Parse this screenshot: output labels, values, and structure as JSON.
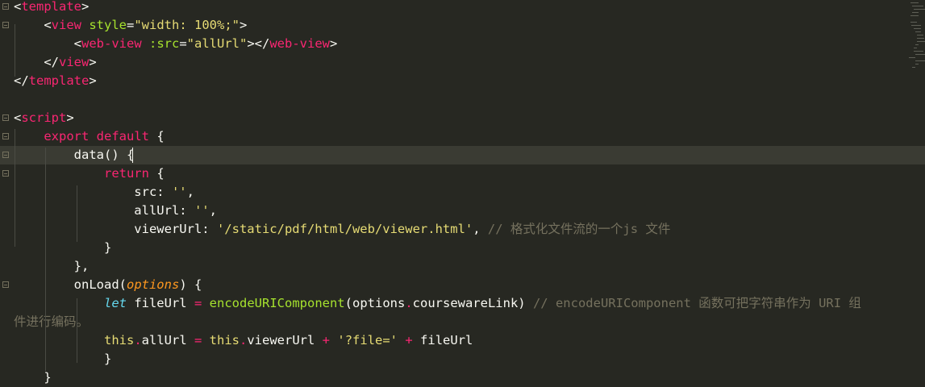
{
  "editor": {
    "lines": [
      [
        {
          "t": "<",
          "c": "w"
        },
        {
          "t": "template",
          "c": "t"
        },
        {
          "t": ">",
          "c": "w"
        }
      ],
      [
        {
          "t": "    <",
          "c": "w"
        },
        {
          "t": "view",
          "c": "t"
        },
        {
          "t": " style",
          "c": "a"
        },
        {
          "t": "=",
          "c": "w"
        },
        {
          "t": "\"width: 100%;\"",
          "c": "s"
        },
        {
          "t": ">",
          "c": "w"
        }
      ],
      [
        {
          "t": "        <",
          "c": "w"
        },
        {
          "t": "web-view",
          "c": "t"
        },
        {
          "t": " :src",
          "c": "a"
        },
        {
          "t": "=",
          "c": "w"
        },
        {
          "t": "\"allUrl\"",
          "c": "s"
        },
        {
          "t": "></",
          "c": "w"
        },
        {
          "t": "web-view",
          "c": "t"
        },
        {
          "t": ">",
          "c": "w"
        }
      ],
      [
        {
          "t": "    </",
          "c": "w"
        },
        {
          "t": "view",
          "c": "t"
        },
        {
          "t": ">",
          "c": "w"
        }
      ],
      [
        {
          "t": "</",
          "c": "w"
        },
        {
          "t": "template",
          "c": "t"
        },
        {
          "t": ">",
          "c": "w"
        }
      ],
      [],
      [
        {
          "t": "<",
          "c": "w"
        },
        {
          "t": "script",
          "c": "t"
        },
        {
          "t": ">",
          "c": "w"
        }
      ],
      [
        {
          "t": "    ",
          "c": "w"
        },
        {
          "t": "export",
          "c": "t"
        },
        {
          "t": " ",
          "c": "w"
        },
        {
          "t": "default",
          "c": "t"
        },
        {
          "t": " {",
          "c": "w"
        }
      ],
      [
        {
          "t": "        data() {",
          "c": "w"
        }
      ],
      [
        {
          "t": "            ",
          "c": "w"
        },
        {
          "t": "return",
          "c": "t"
        },
        {
          "t": " {",
          "c": "w"
        }
      ],
      [
        {
          "t": "                src: ",
          "c": "w"
        },
        {
          "t": "''",
          "c": "s"
        },
        {
          "t": ",",
          "c": "w"
        }
      ],
      [
        {
          "t": "                allUrl: ",
          "c": "w"
        },
        {
          "t": "''",
          "c": "s"
        },
        {
          "t": ",",
          "c": "w"
        }
      ],
      [
        {
          "t": "                viewerUrl: ",
          "c": "w"
        },
        {
          "t": "'/static/pdf/html/web/viewer.html'",
          "c": "s"
        },
        {
          "t": ", ",
          "c": "w"
        },
        {
          "t": "// 格式化文件流的一个js 文件",
          "c": "c"
        }
      ],
      [
        {
          "t": "            }",
          "c": "w"
        }
      ],
      [
        {
          "t": "        },",
          "c": "w"
        }
      ],
      [
        {
          "t": "        onLoad(",
          "c": "w"
        },
        {
          "t": "options",
          "c": "p"
        },
        {
          "t": ") {",
          "c": "w"
        }
      ],
      [
        {
          "t": "            ",
          "c": "w"
        },
        {
          "t": "let",
          "c": "b"
        },
        {
          "t": " fileUrl ",
          "c": "w"
        },
        {
          "t": "=",
          "c": "t"
        },
        {
          "t": " ",
          "c": "w"
        },
        {
          "t": "encodeURIComponent",
          "c": "a"
        },
        {
          "t": "(options",
          "c": "w"
        },
        {
          "t": ".",
          "c": "t"
        },
        {
          "t": "coursewareLink) ",
          "c": "w"
        },
        {
          "t": "// encodeURIComponent 函数可把字符串作为 URI 组",
          "c": "c"
        }
      ],
      [
        {
          "t": "件进行编码。",
          "c": "c"
        }
      ],
      [
        {
          "t": "            ",
          "c": "w"
        },
        {
          "t": "this",
          "c": "s"
        },
        {
          "t": ".",
          "c": "t"
        },
        {
          "t": "allUrl ",
          "c": "w"
        },
        {
          "t": "=",
          "c": "t"
        },
        {
          "t": " ",
          "c": "w"
        },
        {
          "t": "this",
          "c": "s"
        },
        {
          "t": ".",
          "c": "t"
        },
        {
          "t": "viewerUrl ",
          "c": "w"
        },
        {
          "t": "+",
          "c": "t"
        },
        {
          "t": " ",
          "c": "w"
        },
        {
          "t": "'?file='",
          "c": "s"
        },
        {
          "t": " ",
          "c": "w"
        },
        {
          "t": "+",
          "c": "t"
        },
        {
          "t": " fileUrl",
          "c": "w"
        }
      ],
      [
        {
          "t": "            }",
          "c": "w"
        }
      ],
      [
        {
          "t": "    }",
          "c": "w"
        }
      ]
    ]
  },
  "theme": {
    "background": "#272822",
    "active_line": "#3a3b33",
    "keyword": "#f92672",
    "attribute": "#a6e22e",
    "string": "#e6db74",
    "comment": "#75715e"
  }
}
